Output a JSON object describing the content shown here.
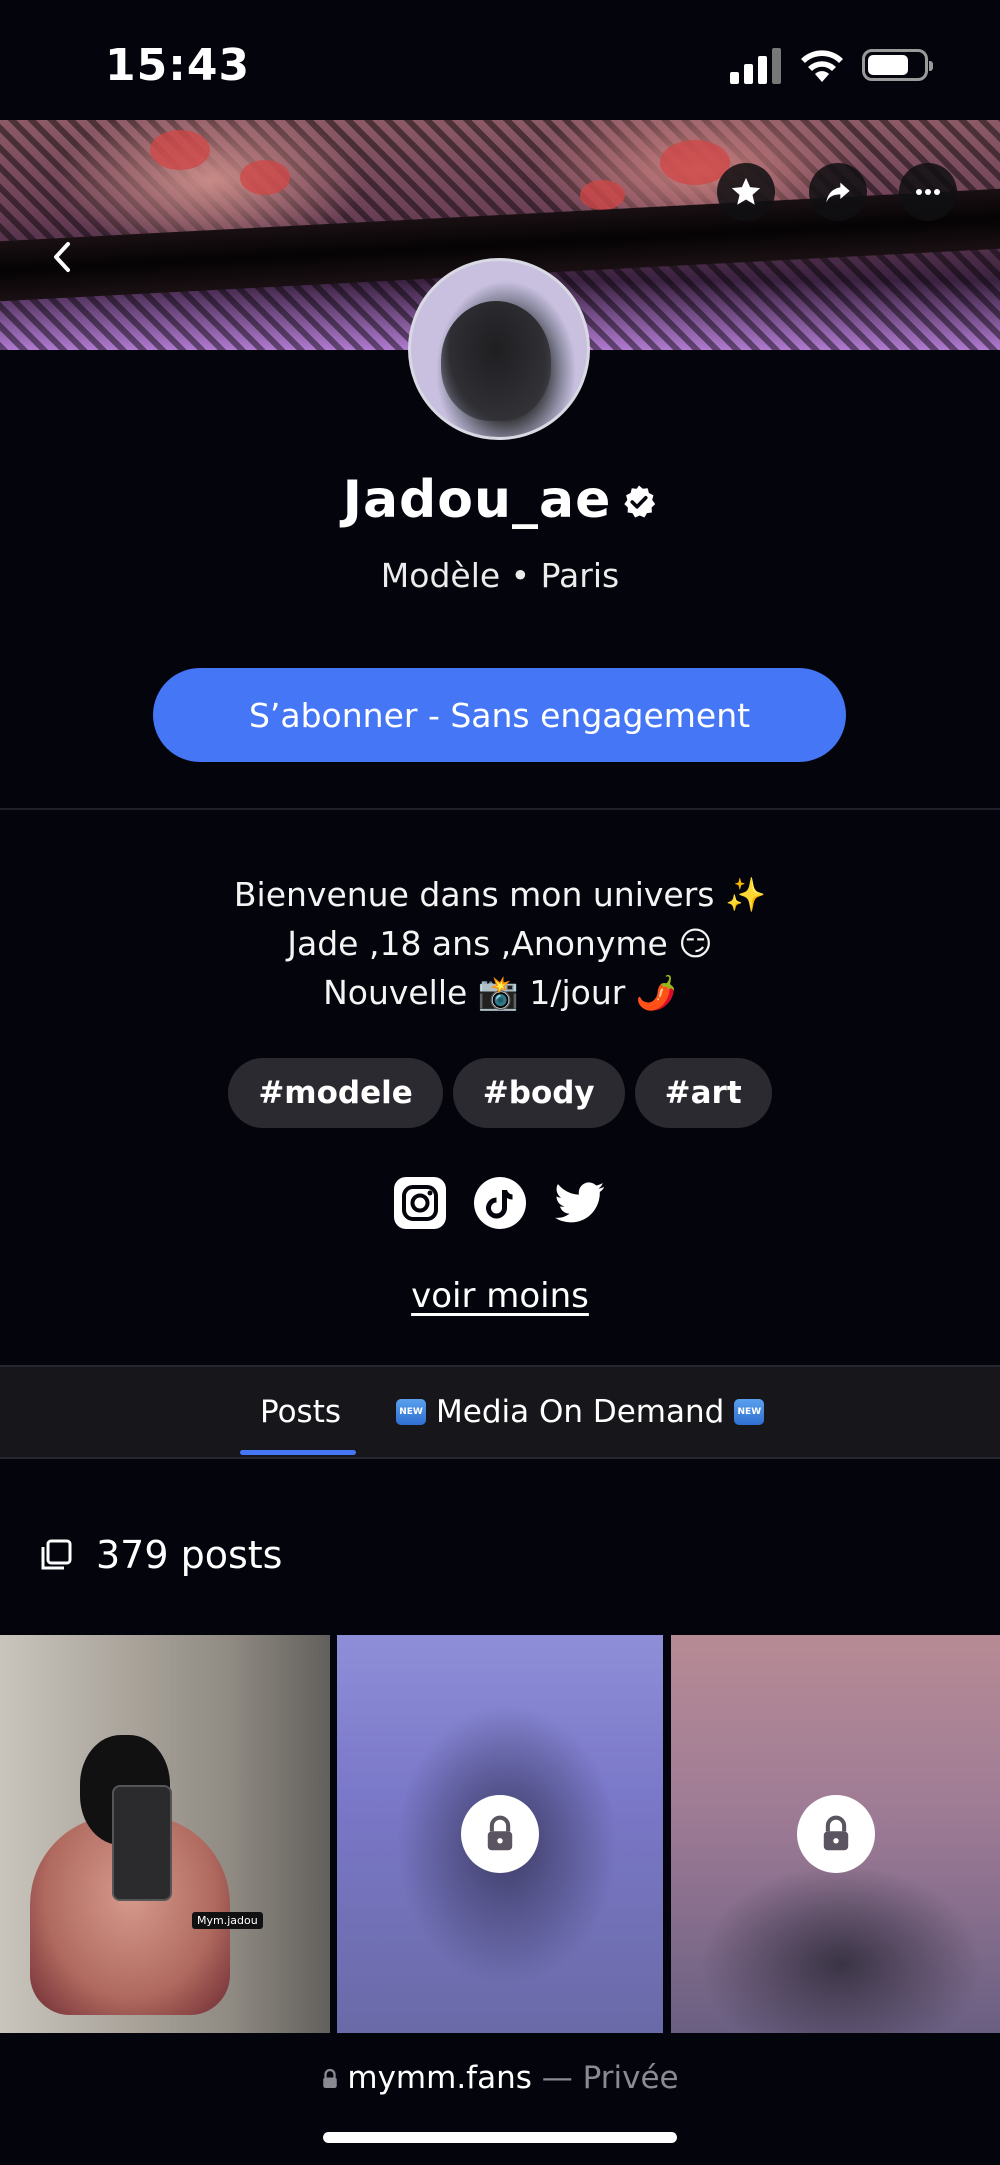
{
  "status_bar": {
    "time": "15:43"
  },
  "profile": {
    "name": "Jadou_ae",
    "subtitle": "Modèle • Paris",
    "subscribe_label": "S’abonner - Sans engagement"
  },
  "bio": {
    "lines": [
      "Bienvenue dans mon univers ✨",
      "Jade ,18 ans ,Anonyme 😏",
      "Nouvelle 📸 1/jour 🌶️"
    ]
  },
  "tags": [
    "#modele",
    "#body",
    "#art"
  ],
  "socials": [
    "instagram-icon",
    "tiktok-icon",
    "twitter-icon"
  ],
  "voir_moins": "voir moins",
  "tabs": [
    {
      "label": "Posts",
      "active": true
    },
    {
      "label": "Media On Demand",
      "badge": "NEW",
      "active": false
    }
  ],
  "posts": {
    "count_label": "379 posts"
  },
  "grid": [
    {
      "locked": false,
      "watermark": "Mym.jadou"
    },
    {
      "locked": true
    },
    {
      "locked": true
    }
  ],
  "browser": {
    "url": "mymm.fans",
    "separator": " — ",
    "mode": "Privée"
  },
  "colors": {
    "accent": "#4576f5",
    "background": "#04050c",
    "tag_bg": "#2a2a30"
  }
}
